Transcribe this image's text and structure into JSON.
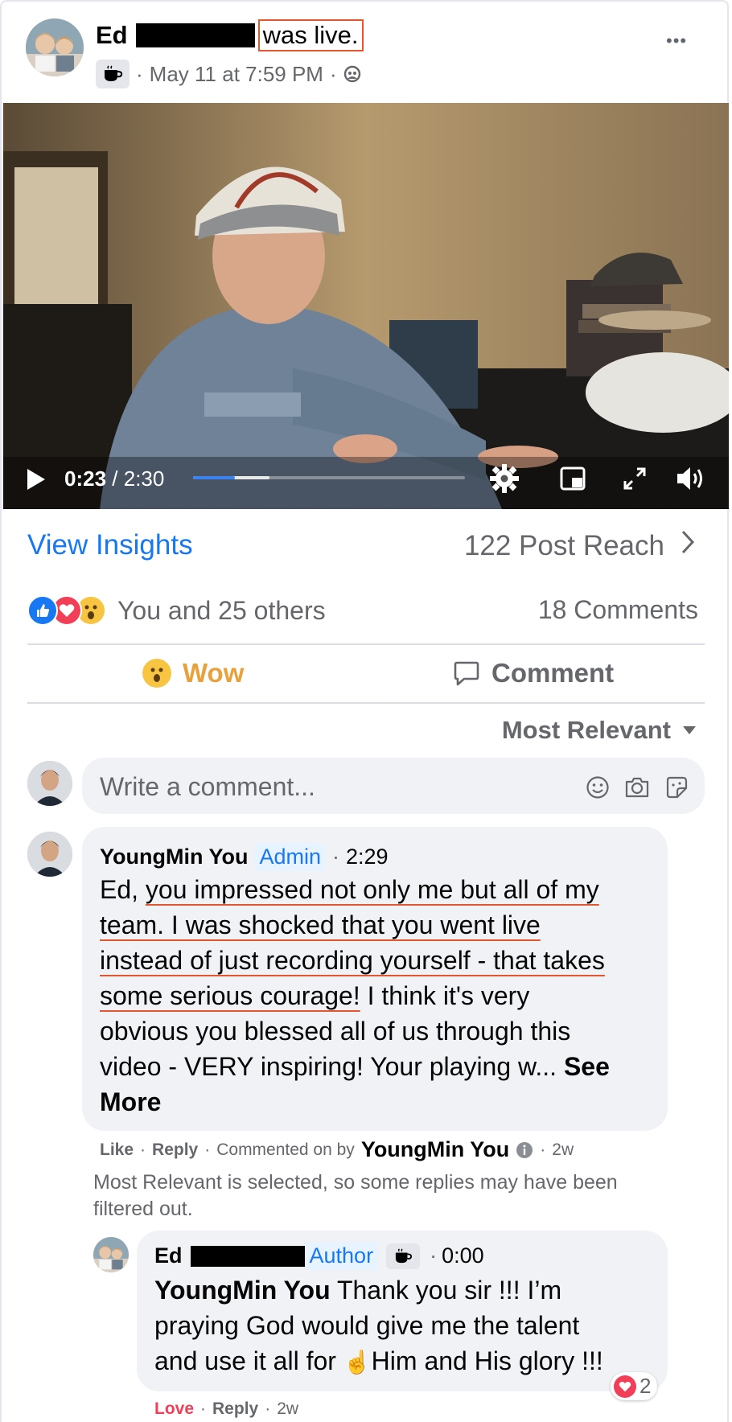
{
  "post": {
    "author_first": "Ed",
    "status": "was live.",
    "timestamp": "May 11 at 7:59 PM",
    "separator": "·",
    "more_label": "•••"
  },
  "video": {
    "current_time": "0:23",
    "duration": "/ 2:30",
    "progress_fraction": 0.153,
    "buffered_fraction": 0.28
  },
  "insights": {
    "view_label": "View Insights",
    "reach_label": "122 Post Reach",
    "chevron": "›"
  },
  "reactions": {
    "summary": "You and 25 others",
    "comments_count": "18 Comments",
    "icons": [
      "like-icon",
      "love-icon",
      "wow-icon"
    ]
  },
  "actions": {
    "wow_label": "Wow",
    "comment_label": "Comment"
  },
  "sort": {
    "label": "Most Relevant"
  },
  "composer": {
    "placeholder": "Write a comment..."
  },
  "comments": [
    {
      "author": "YoungMin You",
      "badge": "Admin",
      "timecode": "2:29",
      "text_start": "Ed, ",
      "text_underlined_1": "you impressed not only me but all of my",
      "text_underlined_2": "team. I was shocked that you went live",
      "text_underlined_3": "instead of just recording yourself - that takes",
      "text_underlined_4": "some serious courage!",
      "text_rest_1": " I think it's very",
      "text_rest_2": "obvious you blessed all of us through this",
      "text_rest_3": "video - VERY inspiring! Your playing w... ",
      "see_more": "See",
      "see_more_2": "More",
      "like_label": "Like",
      "reply_label": "Reply",
      "commented_on_by": "Commented on by",
      "commented_by_name": "YoungMin You",
      "age": "2w"
    }
  ],
  "filter_notice": {
    "line1": "Most Relevant is selected, so some replies may have been",
    "line2": "filtered out."
  },
  "reply": {
    "author_first": "Ed",
    "badge": "Author",
    "timecode": "0:00",
    "mention": "YoungMin You",
    "text_1": " Thank you sir !!! I’m",
    "text_2": "praying God would give me the talent",
    "text_3a": "and use it all for ",
    "text_3b": "Him and His glory !!!",
    "love_label": "Love",
    "reply_label": "Reply",
    "age": "2w",
    "reaction_count": "2",
    "emoji": "☝"
  },
  "colors": {
    "accent": "#1877f2",
    "red_annotation": "#e4572e",
    "wow_yellow": "#e9a23b",
    "love_red": "#f33e58"
  }
}
